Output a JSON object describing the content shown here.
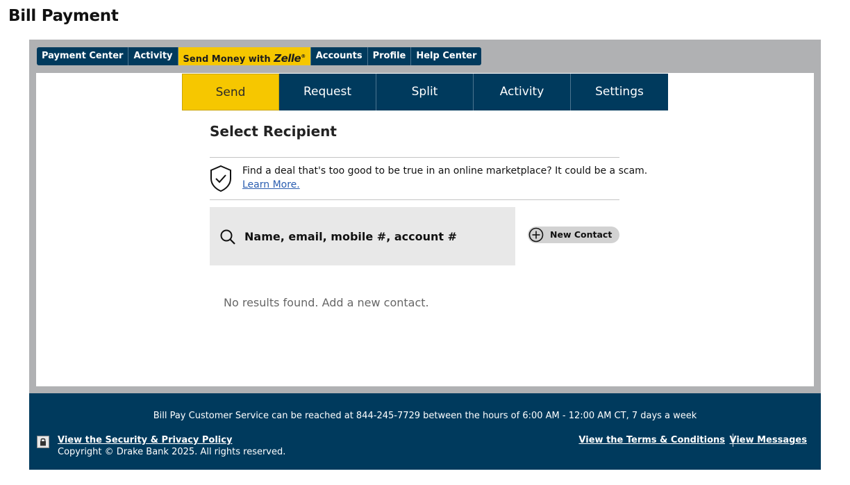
{
  "page": {
    "title": "Bill Payment"
  },
  "topnav": {
    "items": [
      {
        "label": "Payment Center"
      },
      {
        "label": "Activity"
      },
      {
        "label": "Send Money with",
        "logo": "Zelle",
        "logo_mark": "®"
      },
      {
        "label": "Accounts"
      },
      {
        "label": "Profile"
      },
      {
        "label": "Help Center"
      }
    ],
    "accent_color": "#f6c700",
    "brand_color": "#003a5d"
  },
  "tabs": [
    {
      "label": "Send",
      "active": true
    },
    {
      "label": "Request"
    },
    {
      "label": "Split"
    },
    {
      "label": "Activity"
    },
    {
      "label": "Settings"
    }
  ],
  "main": {
    "section_title": "Select Recipient",
    "alert": {
      "icon": "shield-check-icon",
      "message": "Find a deal that's too good to be true in an online marketplace? It could be a scam.",
      "link": "Learn More."
    },
    "search": {
      "icon": "search-icon",
      "placeholder": "Name, email, mobile #, account #",
      "value": ""
    },
    "new_contact": {
      "icon": "plus-circle-icon",
      "label": "New Contact"
    },
    "empty_state": "No results found. Add a new contact."
  },
  "footer": {
    "service_text": "Bill Pay Customer Service can be reached at 844-245-7729 between the hours of 6:00 AM - 12:00 AM CT, 7 days a week",
    "lock_icon": "lock-icon",
    "security_link": "View the Security & Privacy Policy",
    "copyright": "Copyright © Drake Bank 2025. All rights reserved.",
    "terms_link": "View the Terms & Conditions",
    "messages_link": "View Messages"
  }
}
